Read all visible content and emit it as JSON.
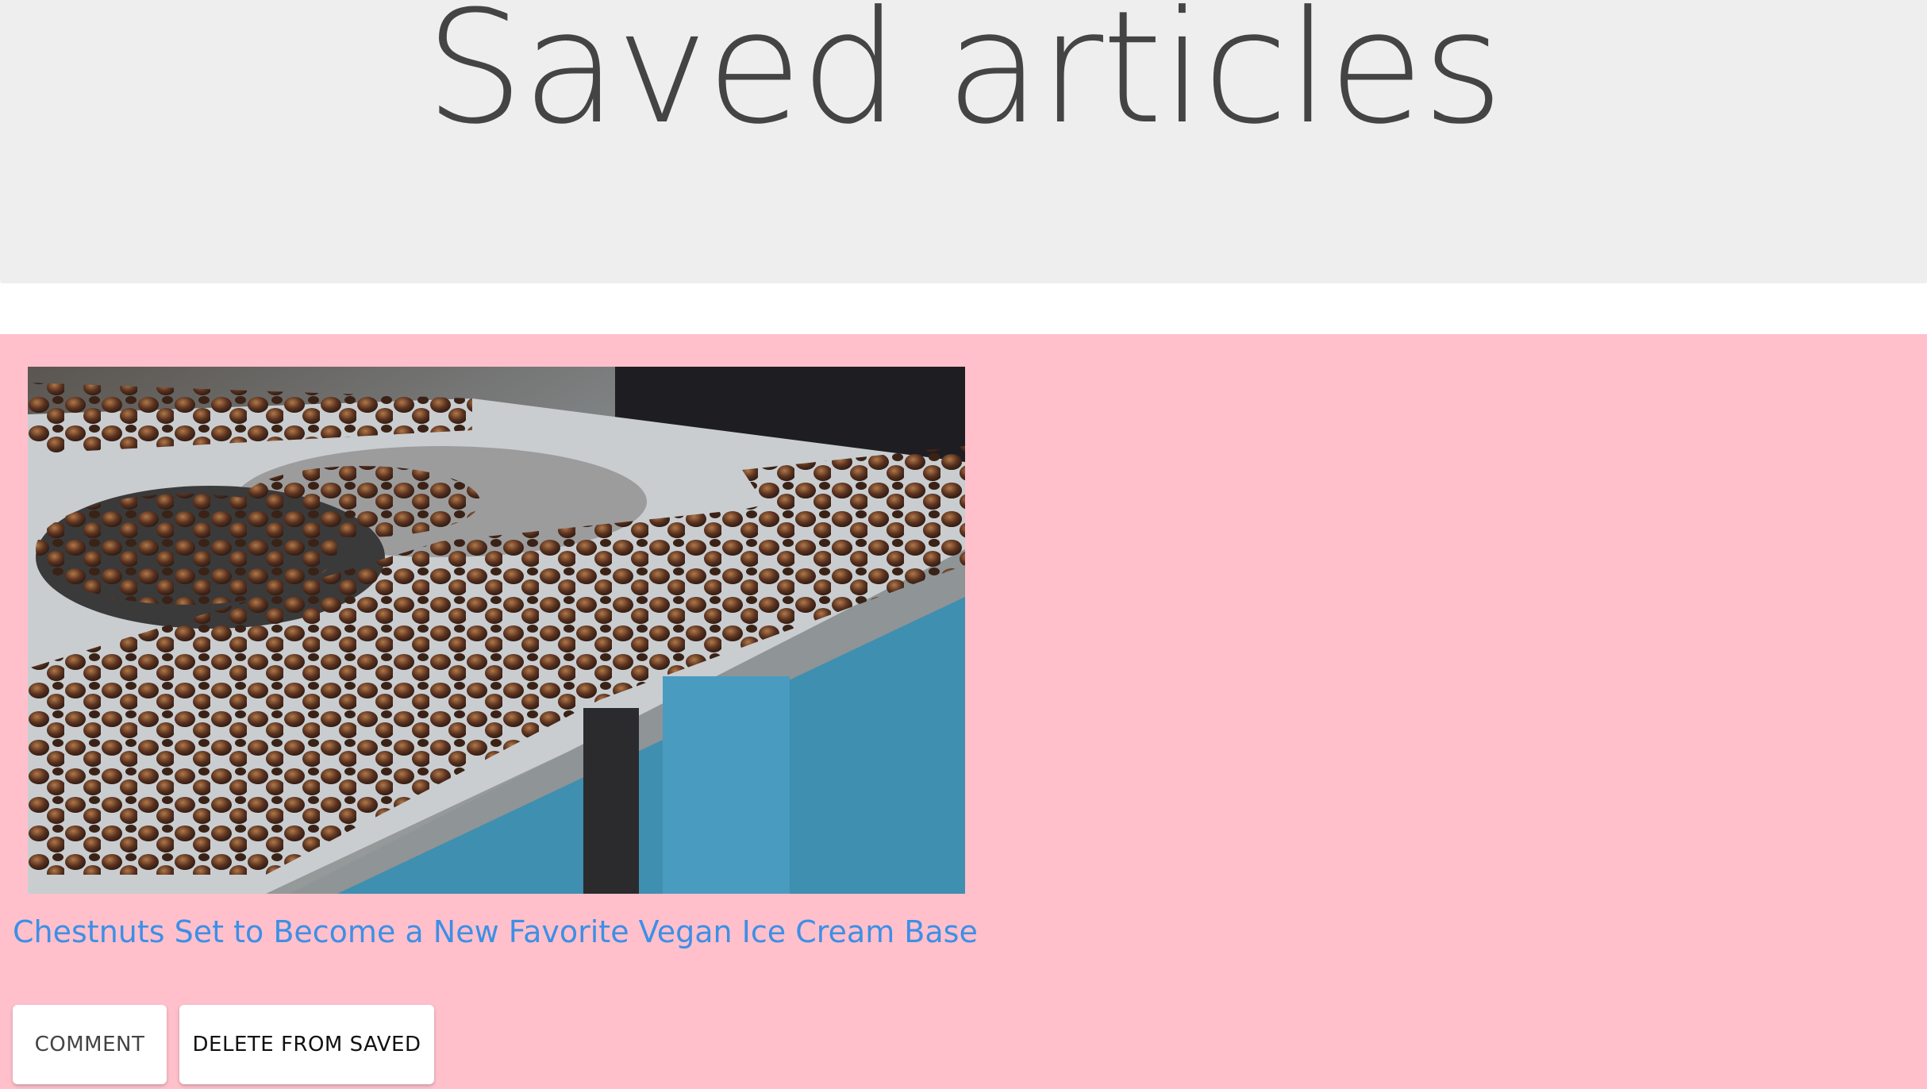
{
  "header": {
    "title": "Saved articles",
    "background": "#eeeeee"
  },
  "content": {
    "background": "#ffc0cb"
  },
  "articles": [
    {
      "title": "Chestnuts Set to Become a New Favorite Vegan Ice Cream Base",
      "title_color": "#3d8fe6",
      "image": "roasted-chestnuts-photo",
      "comment_label": "COMMENT",
      "delete_label": "DELETE FROM SAVED"
    }
  ]
}
